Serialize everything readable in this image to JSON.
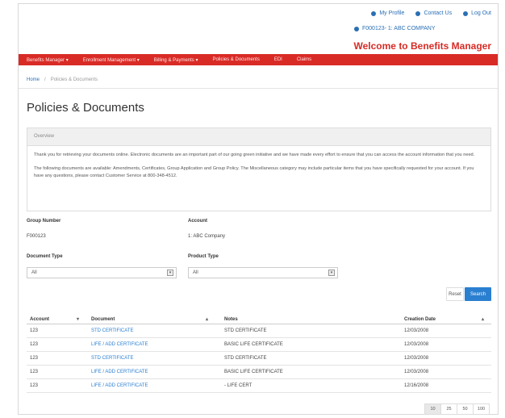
{
  "header": {
    "links": [
      {
        "label": "My Profile",
        "icon": "user-icon"
      },
      {
        "label": "Contact Us",
        "icon": "phone-icon"
      },
      {
        "label": "Log Out",
        "icon": "logout-icon"
      }
    ],
    "company": "F000123- 1: ABC COMPANY",
    "welcome": "Welcome to Benefits Manager"
  },
  "nav": {
    "items": [
      "Benefits Manager ▾",
      "Enrollment Management ▾",
      "Billing & Payments ▾",
      "Policies & Documents",
      "EDI",
      "Claims"
    ]
  },
  "breadcrumb": {
    "home": "Home",
    "sep": "/",
    "current": "Policies & Documents"
  },
  "page": {
    "title": "Policies & Documents"
  },
  "overview": {
    "heading": "Overview",
    "p1": "Thank you for retrieving your documents online. Electronic documents are an important part of our going green initiative and we have made every effort to ensure that you can access the account information that you need.",
    "p2": "The following documents are available: Amendments, Certificates, Group Application and Group Policy. The Miscellaneous category may include particular items that you have specifically requested for your account. If you have any questions, please contact Customer Service at 800-348-4512."
  },
  "filters": {
    "group_label": "Group Number",
    "group_value": "F000123",
    "account_label": "Account",
    "account_value": "1: ABC Company",
    "doctype_label": "Document Type",
    "doctype_value": "All",
    "product_label": "Product Type",
    "product_value": "All",
    "reset": "Reset",
    "search": "Search"
  },
  "table": {
    "headers": [
      "Account",
      "Document",
      "Notes",
      "Creation Date"
    ],
    "rows": [
      {
        "account": "123",
        "document": "STD CERTIFICATE",
        "notes": "STD CERTIFICATE",
        "date": "12/03/2008"
      },
      {
        "account": "123",
        "document": "LIFE / ADD CERTIFICATE",
        "notes": "BASIC LIFE CERTIFICATE",
        "date": "12/03/2008"
      },
      {
        "account": "123",
        "document": "STD CERTIFICATE",
        "notes": "STD CERTIFICATE",
        "date": "12/03/2008"
      },
      {
        "account": "123",
        "document": "LIFE / ADD CERTIFICATE",
        "notes": "BASIC LIFE CERTIFICATE",
        "date": "12/03/2008"
      },
      {
        "account": "123",
        "document": "LIFE / ADD CERTIFICATE",
        "notes": "- LIFE CERT",
        "date": "12/16/2008"
      }
    ]
  },
  "pager": [
    "10",
    "25",
    "50",
    "100"
  ],
  "colors": {
    "brand_red": "#d92b26",
    "link_blue": "#2a6fb5",
    "button_blue": "#2a7fd0"
  }
}
